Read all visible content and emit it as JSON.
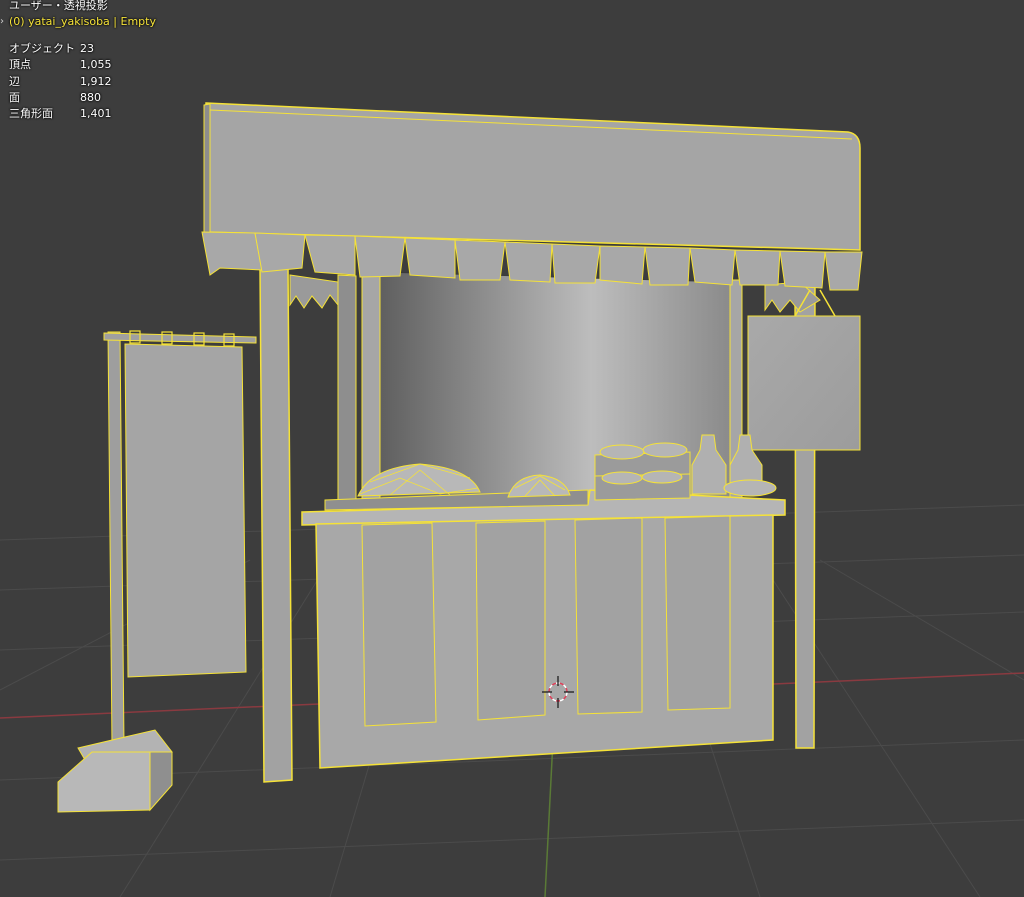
{
  "viewport": {
    "view_mode": "ユーザー・透視投影",
    "active_object": "(0) yatai_yakisoba | Empty",
    "collapse_icon": "chevron-right-icon",
    "stats": [
      {
        "label": "オブジェクト",
        "value": "23"
      },
      {
        "label": "頂点",
        "value": "1,055"
      },
      {
        "label": "辺",
        "value": "1,912"
      },
      {
        "label": "面",
        "value": "880"
      },
      {
        "label": "三角形面",
        "value": "1,401"
      }
    ]
  },
  "colors": {
    "background": "#3d3d3d",
    "grid": "#4b4b4b",
    "x_axis": "#8a3a40",
    "y_axis": "#5a7a36",
    "selection_outline": "#f5e238",
    "mesh_fill": "#a2a2a2"
  }
}
